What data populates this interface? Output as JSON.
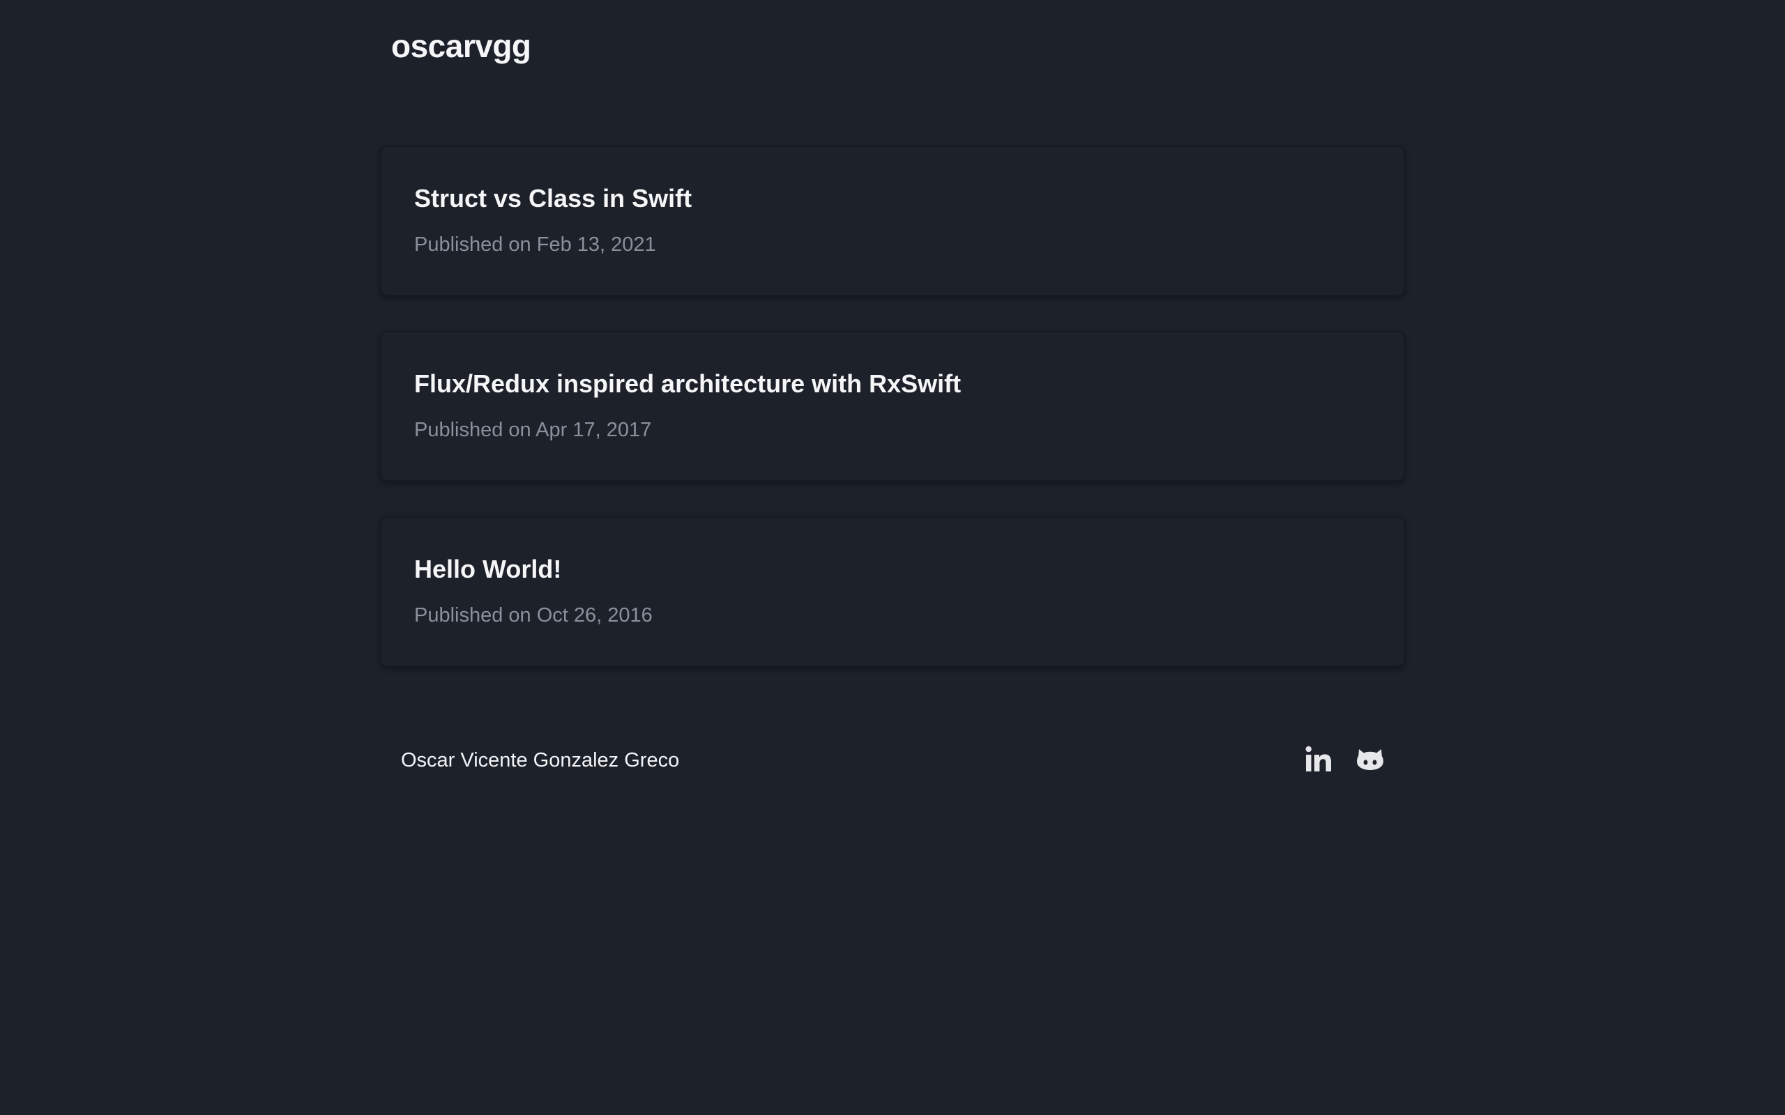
{
  "site": {
    "title": "oscarvgg"
  },
  "posts": [
    {
      "title": "Struct vs Class in Swift",
      "date": "Published on Feb 13, 2021"
    },
    {
      "title": "Flux/Redux inspired architecture with RxSwift",
      "date": "Published on Apr 17, 2017"
    },
    {
      "title": "Hello World!",
      "date": "Published on Oct 26, 2016"
    }
  ],
  "footer": {
    "author": "Oscar Vicente Gonzalez Greco",
    "social": [
      {
        "icon": "linkedin-icon"
      },
      {
        "icon": "github-icon"
      }
    ]
  },
  "colors": {
    "background": "#1c212a",
    "card_background": "#1d212a",
    "text_primary": "#f5f6f8",
    "text_muted": "#8b919b"
  }
}
